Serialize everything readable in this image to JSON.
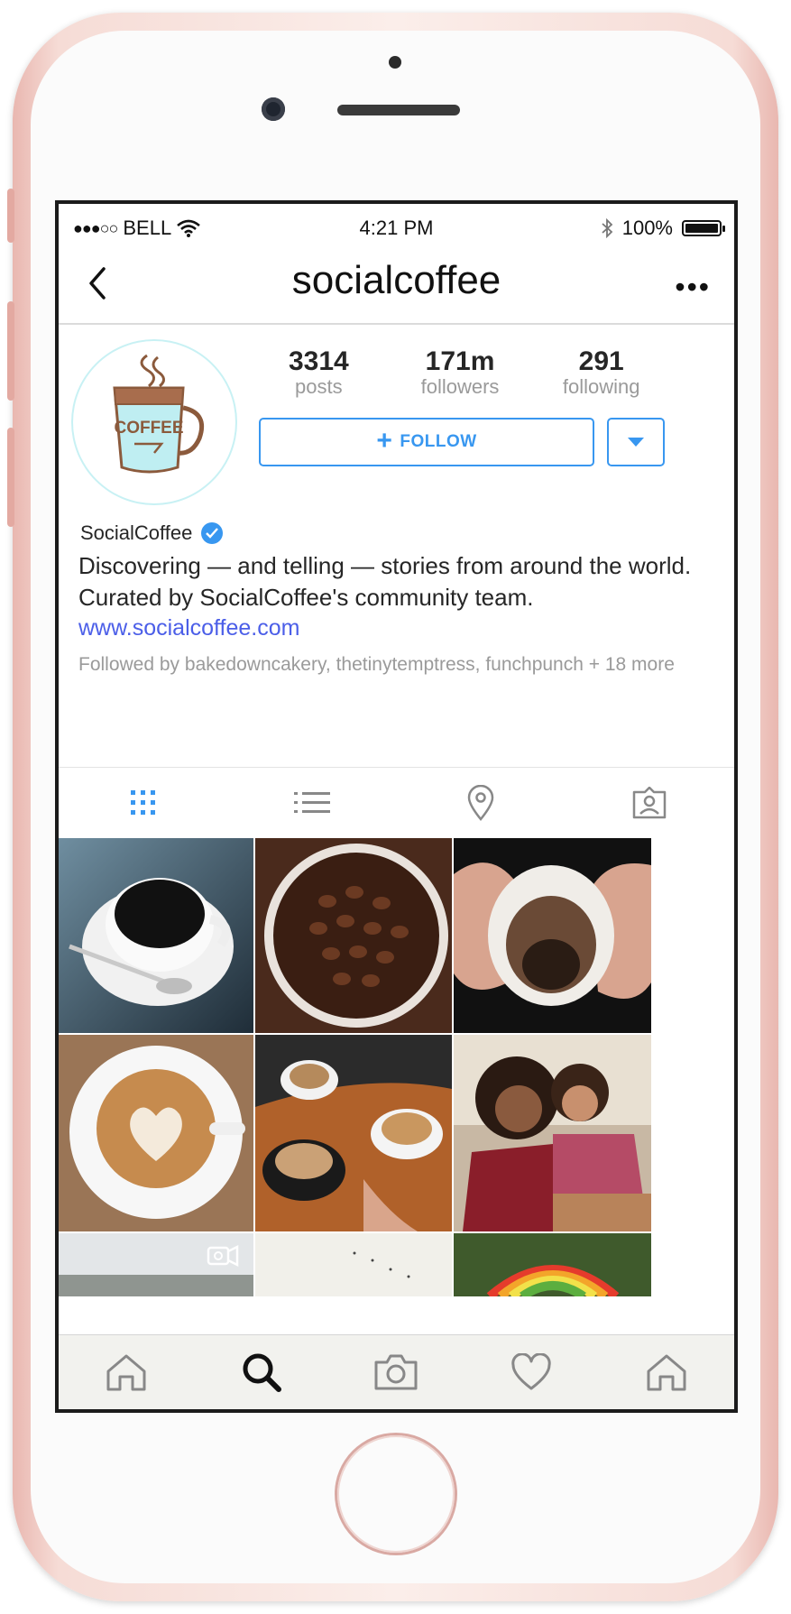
{
  "status_bar": {
    "carrier": "BELL",
    "signal_dots": "●●●○○",
    "time": "4:21 PM",
    "battery": "100%"
  },
  "nav": {
    "title": "socialcoffee",
    "back_icon": "chevron-left-icon",
    "more_icon": "more-horizontal-icon"
  },
  "profile": {
    "avatar_text": "COFFEE",
    "stats": [
      {
        "value": "3314",
        "label": "posts"
      },
      {
        "value": "171m",
        "label": "followers"
      },
      {
        "value": "291",
        "label": "following"
      }
    ],
    "follow_label": "FOLLOW",
    "display_name": "SocialCoffee",
    "bio": "Discovering — and telling — stories from around the world. Curated by SocialCoffee's community team.",
    "website": "www.socialcoffee.com",
    "followed_by": "Followed by bakedowncakery, thetinytemptress, funchpunch + 18 more"
  },
  "tabs": [
    {
      "icon": "grid-icon",
      "active": true
    },
    {
      "icon": "list-icon",
      "active": false
    },
    {
      "icon": "location-pin-icon",
      "active": false
    },
    {
      "icon": "tagged-person-icon",
      "active": false
    }
  ],
  "bottom_bar": [
    {
      "icon": "home-icon"
    },
    {
      "icon": "search-icon",
      "active": true
    },
    {
      "icon": "camera-icon"
    },
    {
      "icon": "heart-icon"
    },
    {
      "icon": "profile-home-icon"
    }
  ],
  "colors": {
    "accent": "#3897f0",
    "link": "#4b5ee8",
    "muted": "#9a9a9a",
    "text": "#262626"
  }
}
